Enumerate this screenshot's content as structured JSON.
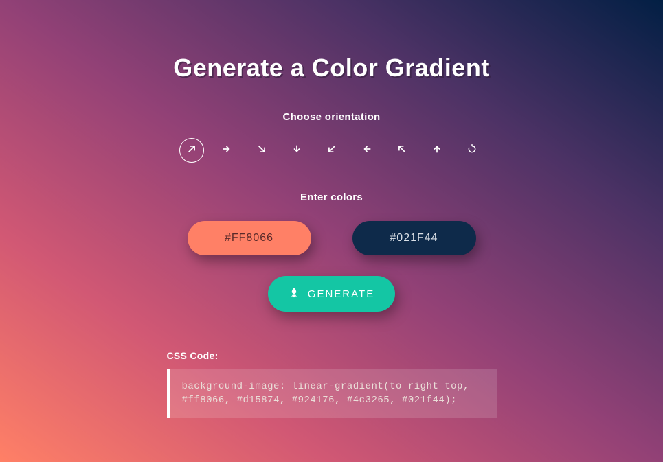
{
  "title": "Generate a Color Gradient",
  "orientation": {
    "label": "Choose orientation"
  },
  "colors": {
    "label": "Enter colors",
    "c1": "#FF8066",
    "c2": "#021F44"
  },
  "generate": {
    "label": "GENERATE"
  },
  "css": {
    "label": "CSS Code:",
    "code": "background-image: linear-gradient(to right top, #ff8066, #d15874, #924176, #4c3265, #021f44);"
  }
}
